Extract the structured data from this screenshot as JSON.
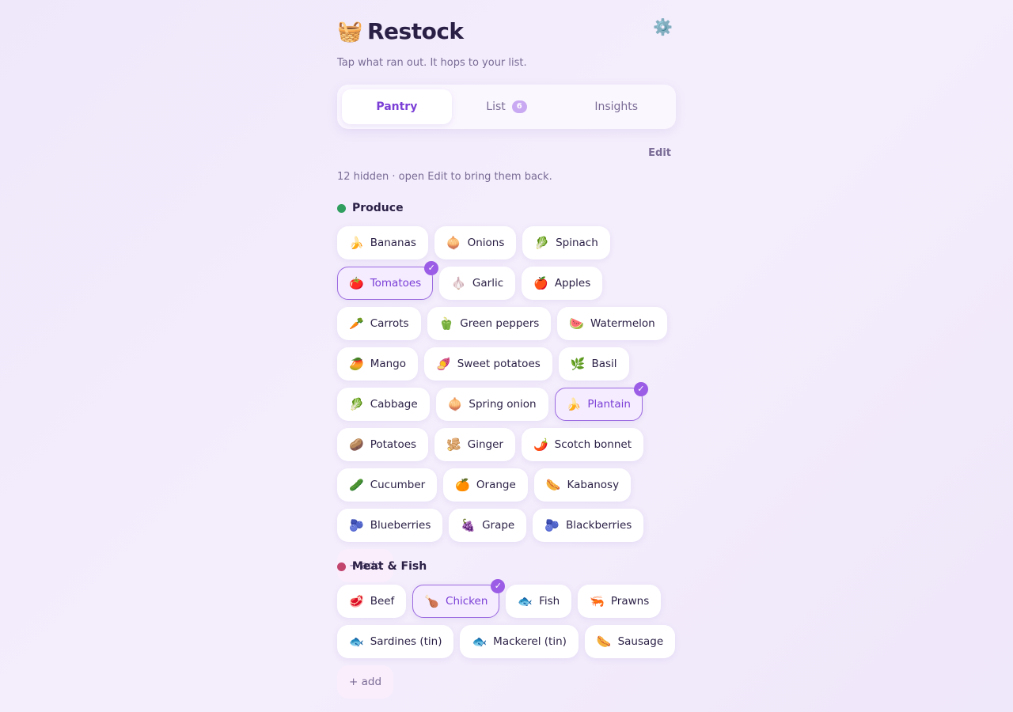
{
  "header": {
    "logo_icon": "🧺",
    "title": "Restock",
    "settings_icon": "⚙️",
    "subtitle": "Tap what ran out. It hops to your list."
  },
  "tabs": [
    {
      "label": "Pantry",
      "active": true
    },
    {
      "label": "List",
      "badge": "6"
    },
    {
      "label": "Insights"
    }
  ],
  "edit_label": "Edit",
  "hidden_note": "12 hidden · open Edit to bring them back.",
  "check_icon": "✓",
  "sections": [
    {
      "title": "Produce",
      "color": "#2f9e5e",
      "items": [
        {
          "emoji": "🍌",
          "label": "Bananas"
        },
        {
          "emoji": "🧅",
          "label": "Onions"
        },
        {
          "emoji": "🥬",
          "label": "Spinach"
        },
        {
          "emoji": "🍅",
          "label": "Tomatoes",
          "selected": true
        },
        {
          "emoji": "🧄",
          "label": "Garlic"
        },
        {
          "emoji": "🍎",
          "label": "Apples"
        },
        {
          "emoji": "🥕",
          "label": "Carrots"
        },
        {
          "emoji": "🫑",
          "label": "Green peppers"
        },
        {
          "emoji": "🍉",
          "label": "Watermelon"
        },
        {
          "emoji": "🥭",
          "label": "Mango"
        },
        {
          "emoji": "🍠",
          "label": "Sweet potatoes"
        },
        {
          "emoji": "🌿",
          "label": "Basil"
        },
        {
          "emoji": "🥬",
          "label": "Cabbage"
        },
        {
          "emoji": "🧅",
          "label": "Spring onion"
        },
        {
          "emoji": "🍌",
          "label": "Plantain",
          "selected": true
        },
        {
          "emoji": "🥔",
          "label": "Potatoes"
        },
        {
          "emoji": "🫚",
          "label": "Ginger"
        },
        {
          "emoji": "🌶️",
          "label": "Scotch bonnet"
        },
        {
          "emoji": "🥒",
          "label": "Cucumber"
        },
        {
          "emoji": "🍊",
          "label": "Orange"
        },
        {
          "emoji": "🌭",
          "label": "Kabanosy"
        },
        {
          "emoji": "🫐",
          "label": "Blueberries"
        },
        {
          "emoji": "🍇",
          "label": "Grape"
        },
        {
          "emoji": "🫐",
          "label": "Blackberries"
        }
      ],
      "add_label": "+ add"
    },
    {
      "title": "Meat & Fish",
      "color": "#c2456e",
      "items": [
        {
          "emoji": "🥩",
          "label": "Beef"
        },
        {
          "emoji": "🍗",
          "label": "Chicken",
          "selected": true
        },
        {
          "emoji": "🐟",
          "label": "Fish"
        },
        {
          "emoji": "🦐",
          "label": "Prawns"
        },
        {
          "emoji": "🐟",
          "label": "Sardines (tin)"
        },
        {
          "emoji": "🐟",
          "label": "Mackerel (tin)"
        },
        {
          "emoji": "🌭",
          "label": "Sausage"
        }
      ],
      "add_label": "+ add"
    }
  ]
}
